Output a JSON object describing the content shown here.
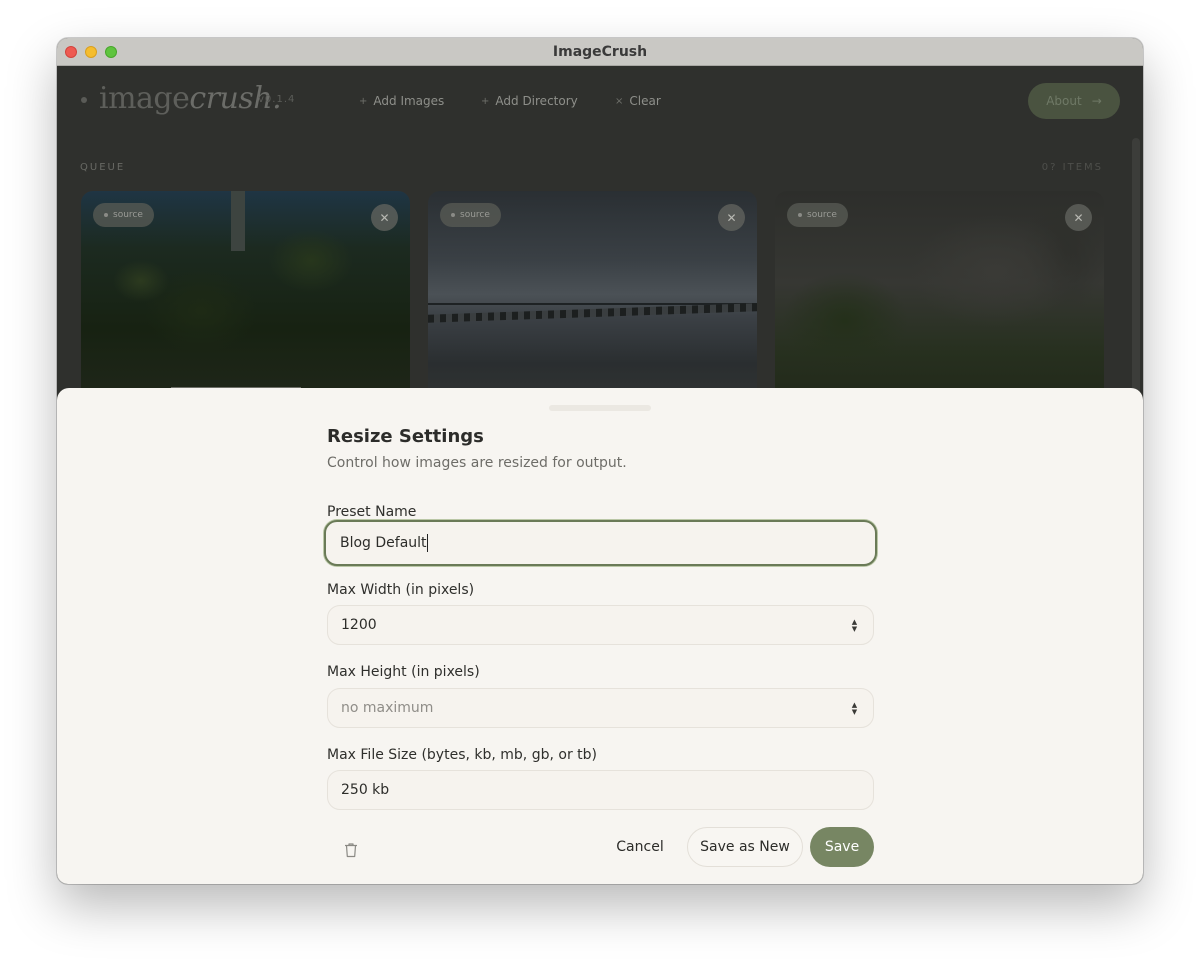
{
  "window": {
    "title": "ImageCrush"
  },
  "header": {
    "logo_main": "image",
    "logo_accent": "crush.",
    "version": "v0.1.4",
    "add_images_label": "Add Images",
    "add_directory_label": "Add Directory",
    "clear_label": "Clear",
    "about_label": "About"
  },
  "queue": {
    "label": "QUEUE",
    "count_label": "0? ITEMS",
    "cards": [
      {
        "badge": "source"
      },
      {
        "badge": "source"
      },
      {
        "badge": "source"
      }
    ]
  },
  "resize_sheet": {
    "title": "Resize Settings",
    "subtitle": "Control how images are resized for output.",
    "preset_name": {
      "label": "Preset Name",
      "value": "Blog Default"
    },
    "max_width": {
      "label": "Max Width (in pixels)",
      "value": "1200"
    },
    "max_height": {
      "label": "Max Height (in pixels)",
      "value": "",
      "placeholder": "no maximum"
    },
    "max_file_size": {
      "label": "Max File Size (bytes, kb, mb, gb, or tb)",
      "value": "250 kb"
    },
    "cancel_label": "Cancel",
    "save_as_new_label": "Save as New",
    "save_label": "Save"
  },
  "colors": {
    "accent": "#778663",
    "focus_ring": "#6a7a57",
    "sheet_bg": "#f7f5f1",
    "app_bg": "#2f302d"
  },
  "icons": [
    "plus-icon",
    "close-icon",
    "arrow-right-icon",
    "trash-icon",
    "stepper-icon"
  ]
}
